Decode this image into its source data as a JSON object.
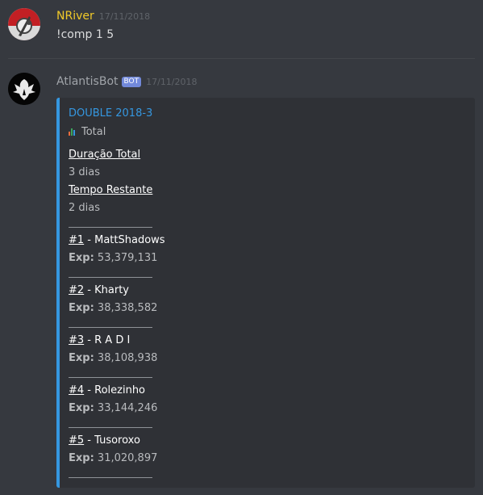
{
  "messages": [
    {
      "author": "NRiver",
      "author_color": "#f0c929",
      "timestamp": "17/11/2018",
      "text": "!comp 1 5"
    },
    {
      "author": "AtlantisBot",
      "author_color": "#a0a4a9",
      "bot_tag": "BOT",
      "timestamp": "17/11/2018",
      "embed": {
        "accent": "#3597e0",
        "title": "DOUBLE 2018-3",
        "icon": "bar-chart-icon",
        "subtitle": "Total",
        "fields": [
          {
            "name": "Duração Total",
            "value": "3 dias"
          },
          {
            "name": "Tempo Restante",
            "value": "2 dias"
          }
        ],
        "separator": "────────",
        "exp_label": "Exp:",
        "ranks": [
          {
            "num": "#1",
            "name": " - MattShadows",
            "exp": "53,379,131"
          },
          {
            "num": "#2",
            "name": " - Kharty",
            "exp": "38,338,582"
          },
          {
            "num": "#3",
            "name": " - R A D I",
            "exp": "38,108,938"
          },
          {
            "num": "#4",
            "name": " - Rolezinho",
            "exp": "33,144,246"
          },
          {
            "num": "#5",
            "name": " - Tusoroxo",
            "exp": "31,020,897"
          }
        ]
      }
    }
  ]
}
